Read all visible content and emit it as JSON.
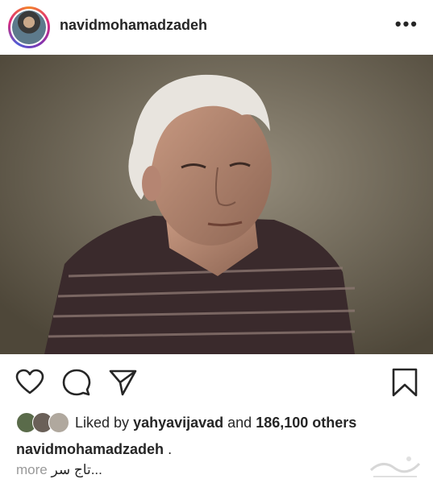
{
  "header": {
    "username": "navidmohamadzadeh",
    "more_icon": "more-horizontal-icon"
  },
  "post": {
    "image": "photo-elderly-man-striped-shirt"
  },
  "actions": {
    "like_icon": "heart-icon",
    "comment_icon": "comment-icon",
    "share_icon": "paper-plane-icon",
    "save_icon": "bookmark-icon"
  },
  "likes": {
    "prefix": "Liked by",
    "liker": "yahyavijavad",
    "middle": "and",
    "others": "186,100 others"
  },
  "caption": {
    "username": "navidmohamadzadeh",
    "suffix": ".",
    "more_label": "more",
    "text": "تاج سر..."
  },
  "colors": {
    "text": "#262626",
    "muted": "#999999",
    "story_ring_start": "#f58529",
    "story_ring_end": "#515bd4"
  }
}
